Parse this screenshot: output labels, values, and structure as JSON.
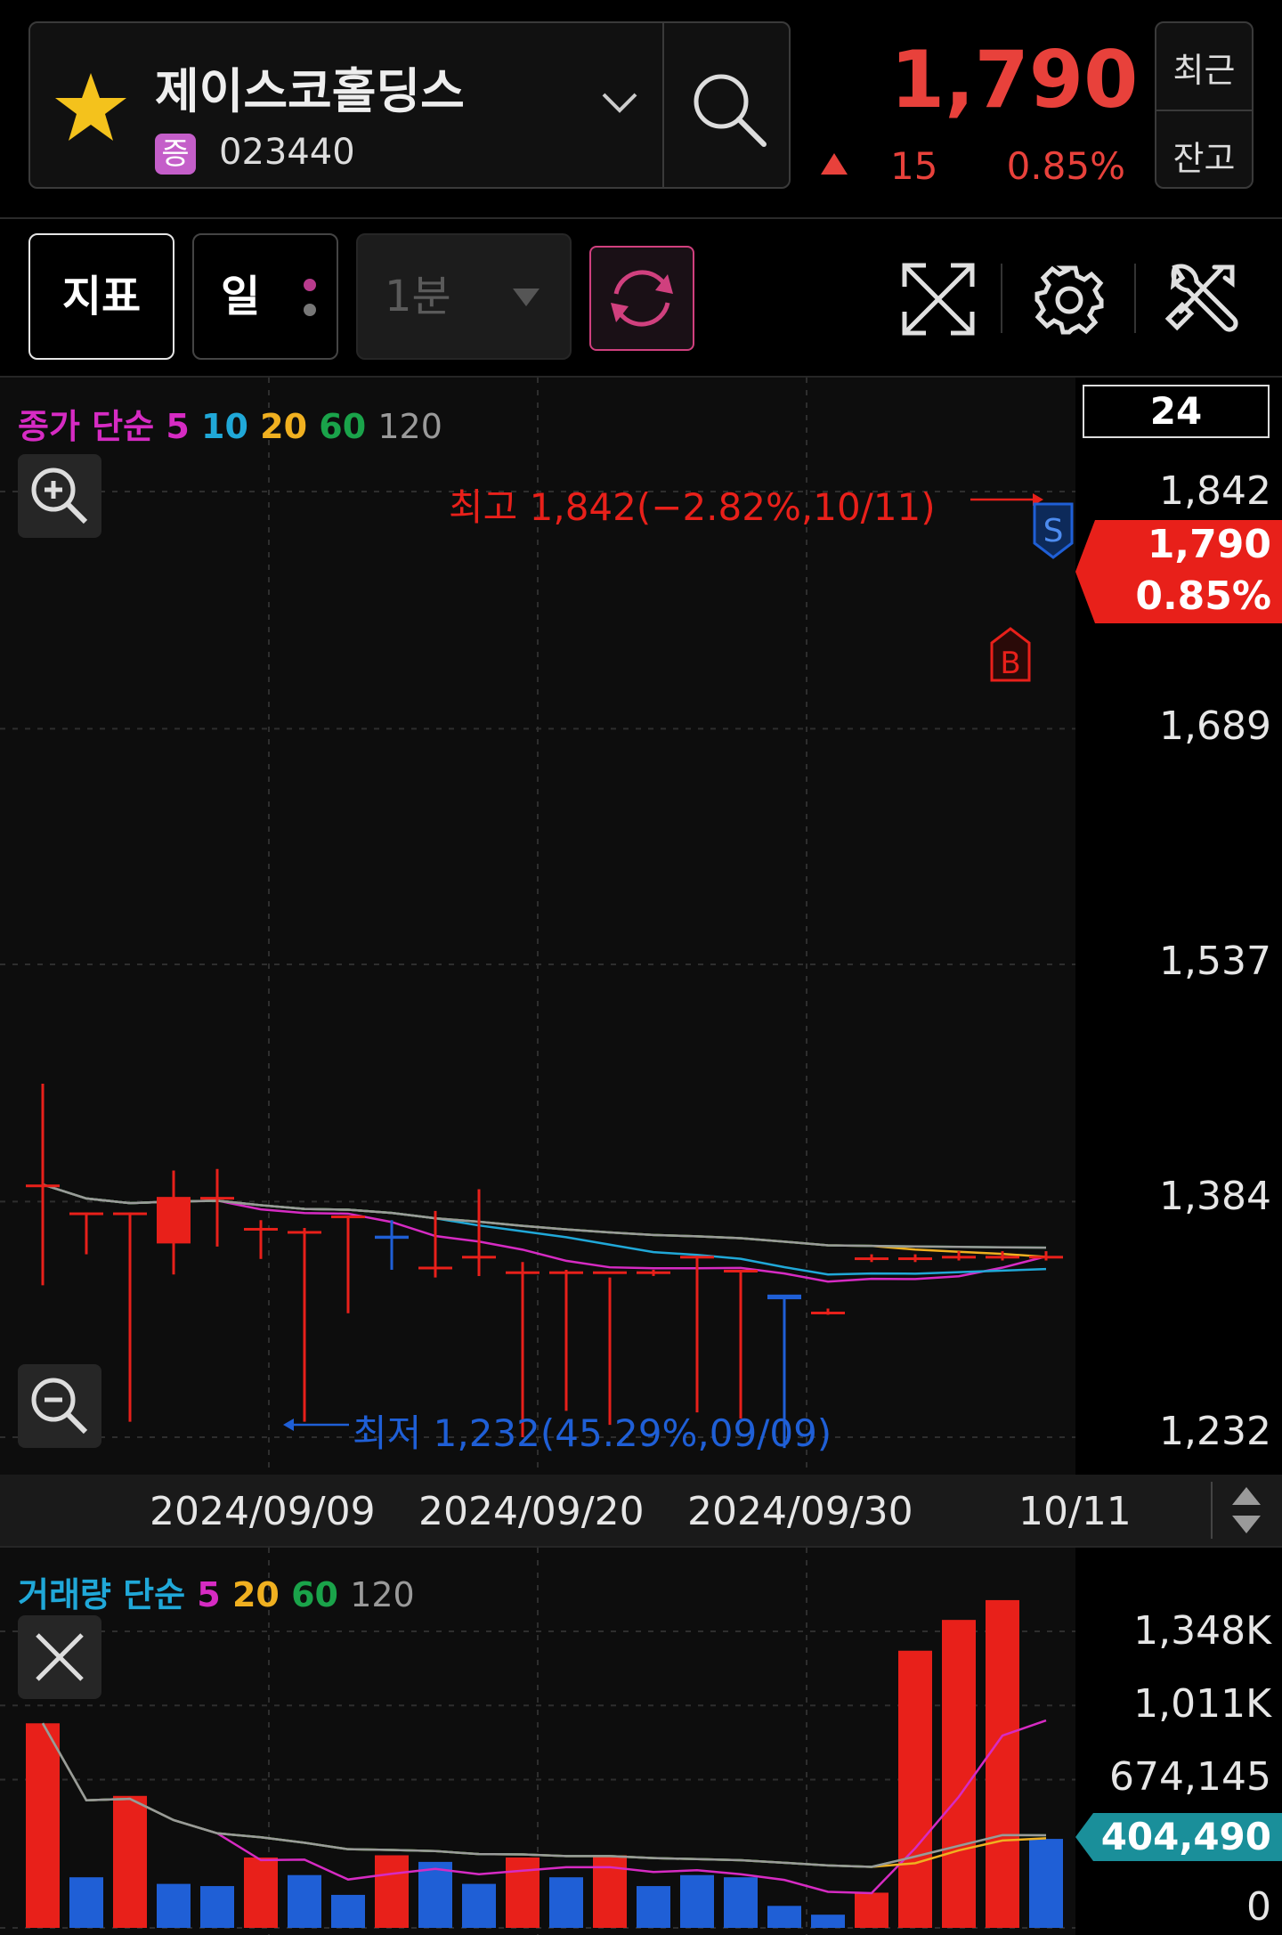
{
  "header": {
    "stock_name": "제이스코홀딩스",
    "badge": "증",
    "code": "023440",
    "price": "1,790",
    "change": "15",
    "change_pct": "0.85%",
    "recent_label_1": "최근",
    "recent_label_2": "잔고"
  },
  "toolbar": {
    "indicator_label": "지표",
    "period_label": "일",
    "interval_label": "1분"
  },
  "price_chart": {
    "legend_prefix": "종가 단순",
    "legend_periods": [
      "5",
      "10",
      "20",
      "60",
      "120"
    ],
    "count_box": "24",
    "y_labels": [
      "1,842",
      "1,689",
      "1,537",
      "1,384",
      "1,232"
    ],
    "current_price": "1,790",
    "current_pct": "0.85%",
    "high_annotation": "최고 1,842(−2.82%,10/11)",
    "low_annotation": "최저 1,232(45.29%,09/09)",
    "buy_marker": "B",
    "sell_marker": "S",
    "x_labels": [
      "2024/09/09",
      "2024/09/20",
      "2024/09/30",
      "10/11"
    ]
  },
  "volume_chart": {
    "legend_prefix": "거래량 단순",
    "legend_periods": [
      "5",
      "20",
      "60",
      "120"
    ],
    "y_labels": [
      "1,348K",
      "1,011K",
      "674,145",
      "0"
    ],
    "current_volume": "404,490"
  },
  "colors": {
    "up": "#e8201a",
    "down": "#1f5fd6",
    "ma5": "#d62bc3",
    "ma10": "#20a8d8",
    "ma20": "#f0b020",
    "ma60": "#1aa34a",
    "ma120": "#9a9a9a"
  },
  "chart_data": [
    {
      "type": "candlestick",
      "title": "",
      "ylim": [
        1232,
        1842
      ],
      "yticks": [
        1232,
        1384,
        1537,
        1689,
        1842
      ],
      "candles": [
        {
          "open": 1395,
          "high": 1460,
          "low": 1330,
          "close": 1395
        },
        {
          "open": 1377,
          "high": 1377,
          "low": 1350,
          "close": 1377
        },
        {
          "open": 1377,
          "high": 1377,
          "low": 1242,
          "close": 1377
        },
        {
          "open": 1357,
          "high": 1404,
          "low": 1337,
          "close": 1387
        },
        {
          "open": 1387,
          "high": 1405,
          "low": 1355,
          "close": 1387
        },
        {
          "open": 1367,
          "high": 1372,
          "low": 1347,
          "close": 1367
        },
        {
          "open": 1365,
          "high": 1367,
          "low": 1242,
          "close": 1365
        },
        {
          "open": 1375,
          "high": 1375,
          "low": 1312,
          "close": 1375
        },
        {
          "open": 1362,
          "high": 1372,
          "low": 1340,
          "close": 1360
        },
        {
          "open": 1342,
          "high": 1378,
          "low": 1335,
          "close": 1342
        },
        {
          "open": 1349,
          "high": 1392,
          "low": 1336,
          "close": 1349
        },
        {
          "open": 1339,
          "high": 1345,
          "low": 1232,
          "close": 1339
        },
        {
          "open": 1339,
          "high": 1340,
          "low": 1249,
          "close": 1339
        },
        {
          "open": 1339,
          "high": 1335,
          "low": 1240,
          "close": 1339
        },
        {
          "open": 1339,
          "high": 1340,
          "low": 1336,
          "close": 1339
        },
        {
          "open": 1349,
          "high": 1349,
          "low": 1248,
          "close": 1349
        },
        {
          "open": 1340,
          "high": 1340,
          "low": 1244,
          "close": 1340
        },
        {
          "open": 1324,
          "high": 1321,
          "low": 1225,
          "close": 1321
        },
        {
          "open": 1313,
          "high": 1315,
          "low": 1311,
          "close": 1313
        },
        {
          "open": 1348,
          "high": 1350,
          "low": 1345,
          "close": 1348
        },
        {
          "open": 1348,
          "high": 1350,
          "low": 1345,
          "close": 1348
        },
        {
          "open": 1349,
          "high": 1352,
          "low": 1346,
          "close": 1349
        },
        {
          "open": 1349,
          "high": 1352,
          "low": 1346,
          "close": 1349
        },
        {
          "open": 1349,
          "high": 1352,
          "low": 1346,
          "close": 1349
        }
      ],
      "note_candles": "24 daily candles read off the price axis; values in KRW",
      "ma_lines": [
        "5",
        "10",
        "20",
        "60",
        "120"
      ]
    },
    {
      "type": "bar",
      "title": "",
      "ylim": [
        0,
        1348000
      ],
      "yticks": [
        0,
        674145,
        1011000,
        1348000
      ],
      "values": [
        930000,
        230000,
        600000,
        200000,
        190000,
        320000,
        240000,
        150000,
        330000,
        300000,
        200000,
        320000,
        230000,
        330000,
        190000,
        240000,
        230000,
        100000,
        60000,
        160000,
        1260000,
        1400000,
        1490000,
        404490
      ],
      "directions": [
        "up",
        "down",
        "up",
        "down",
        "down",
        "up",
        "down",
        "down",
        "up",
        "down",
        "down",
        "up",
        "down",
        "up",
        "down",
        "down",
        "down",
        "down",
        "down",
        "up",
        "up",
        "up",
        "up",
        "down"
      ]
    }
  ]
}
